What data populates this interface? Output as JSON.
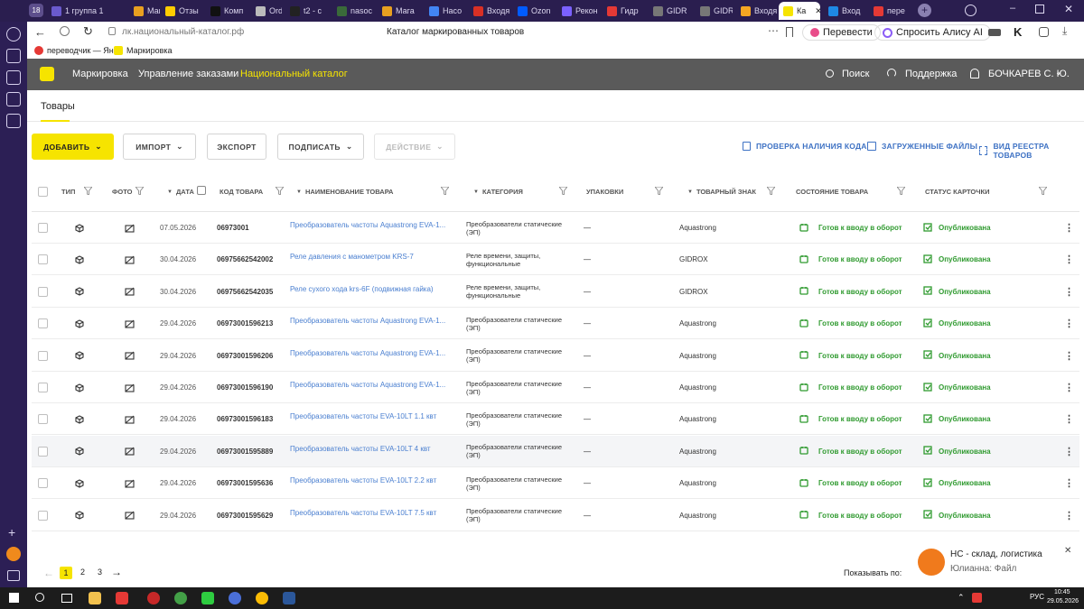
{
  "browser": {
    "tab_count": "18",
    "tabs": [
      {
        "label": "1  группа 1",
        "color": "#6a5acd"
      },
      {
        "label": "Мага",
        "color": "#e8a020"
      },
      {
        "label": "Отзы",
        "color": "#ffcc00"
      },
      {
        "label": "Комп",
        "color": "#111111"
      },
      {
        "label": "Order",
        "color": "#bbbbbb"
      },
      {
        "label": "t2 - c",
        "color": "#222222"
      },
      {
        "label": "nasос",
        "color": "#3a6a3a"
      },
      {
        "label": "Мага",
        "color": "#e8a020"
      },
      {
        "label": "Насо",
        "color": "#4285f4"
      },
      {
        "label": "Входя",
        "color": "#d93025"
      },
      {
        "label": "Ozon",
        "color": "#005bff"
      },
      {
        "label": "Рекон",
        "color": "#7b61ff"
      },
      {
        "label": "Гидр",
        "color": "#e53935"
      },
      {
        "label": "GIDR",
        "color": "#777777"
      },
      {
        "label": "GIDR",
        "color": "#777777"
      },
      {
        "label": "Входя",
        "color": "#f5a623"
      },
      {
        "label": "Ка",
        "color": "#f6e400"
      },
      {
        "label": "Вход",
        "color": "#1e88e5"
      },
      {
        "label": "пере",
        "color": "#e53935"
      }
    ],
    "url": "лк.национальный-каталог.рф",
    "page_title": "Каталог маркированных товаров",
    "translate_label": "Перевести",
    "alice_label": "Спросить Алису AI",
    "bookmarks": [
      "переводчик — Ян",
      "Маркировка"
    ]
  },
  "app": {
    "nav": [
      "Маркировка",
      "Управление заказами",
      "Национальный каталог"
    ],
    "search_label": "Поиск",
    "support_label": "Поддержка",
    "user_label": "БОЧКАРЕВ С. Ю.",
    "subnav_tab": "Товары"
  },
  "toolbar": {
    "add_label": "ДОБАВИТЬ",
    "import_label": "ИМПОРТ",
    "export_label": "ЭКСПОРТ",
    "sign_label": "ПОДПИСАТЬ",
    "action_label": "ДЕЙСТВИЕ",
    "check_code_label": "ПРОВЕРКА НАЛИЧИЯ КОДА",
    "uploaded_files_label": "ЗАГРУЖЕННЫЕ ФАЙЛЫ",
    "registry_view_label": "ВИД РЕЕСТРА ТОВАРОВ"
  },
  "table": {
    "columns": [
      "ТИП",
      "ФОТО",
      "ДАТА",
      "КОД ТОВАРА",
      "НАИМЕНОВАНИЕ ТОВАРА",
      "КАТЕГОРИЯ",
      "УПАКОВКИ",
      "ТОВАРНЫЙ ЗНАК",
      "СОСТОЯНИЕ ТОВАРА",
      "СТАТУС КАРТОЧКИ"
    ],
    "rows": [
      {
        "date": "07.05.2026",
        "code": "06973001",
        "name": "Преобразователь частоты Aquastrong EVA-1...",
        "category": "Преобразователи статические (ЭП)",
        "pack": "—",
        "brand": "Aquastrong",
        "state": "Готов к вводу в оборот",
        "status": "Опубликована"
      },
      {
        "date": "30.04.2026",
        "code": "06975662542002",
        "name": "Реле давления с манометром KRS-7",
        "category": "Реле времени, защиты, функциональные",
        "pack": "—",
        "brand": "GIDROX",
        "state": "Готов к вводу в оборот",
        "status": "Опубликована"
      },
      {
        "date": "30.04.2026",
        "code": "06975662542035",
        "name": "Реле сухого хода krs-6F (подвижная гайка)",
        "category": "Реле времени, защиты, функциональные",
        "pack": "—",
        "brand": "GIDROX",
        "state": "Готов к вводу в оборот",
        "status": "Опубликована"
      },
      {
        "date": "29.04.2026",
        "code": "06973001596213",
        "name": "Преобразователь частоты Aquastrong EVA-1...",
        "category": "Преобразователи статические (ЭП)",
        "pack": "—",
        "brand": "Aquastrong",
        "state": "Готов к вводу в оборот",
        "status": "Опубликована"
      },
      {
        "date": "29.04.2026",
        "code": "06973001596206",
        "name": "Преобразователь частоты Aquastrong EVA-1...",
        "category": "Преобразователи статические (ЭП)",
        "pack": "—",
        "brand": "Aquastrong",
        "state": "Готов к вводу в оборот",
        "status": "Опубликована"
      },
      {
        "date": "29.04.2026",
        "code": "06973001596190",
        "name": "Преобразователь частоты Aquastrong EVA-1...",
        "category": "Преобразователи статические (ЭП)",
        "pack": "—",
        "brand": "Aquastrong",
        "state": "Готов к вводу в оборот",
        "status": "Опубликована"
      },
      {
        "date": "29.04.2026",
        "code": "06973001596183",
        "name": "Преобразователь частоты EVA-10LT 1.1 квт",
        "category": "Преобразователи статические (ЭП)",
        "pack": "—",
        "brand": "Aquastrong",
        "state": "Готов к вводу в оборот",
        "status": "Опубликована"
      },
      {
        "date": "29.04.2026",
        "code": "06973001595889",
        "name": "Преобразователь частоты EVA-10LT 4 квт",
        "category": "Преобразователи статические (ЭП)",
        "pack": "—",
        "brand": "Aquastrong",
        "state": "Готов к вводу в оборот",
        "status": "Опубликована"
      },
      {
        "date": "29.04.2026",
        "code": "06973001595636",
        "name": "Преобразователь частоты EVA-10LT 2.2 квт",
        "category": "Преобразователи статические (ЭП)",
        "pack": "—",
        "brand": "Aquastrong",
        "state": "Готов к вводу в оборот",
        "status": "Опубликована"
      },
      {
        "date": "29.04.2026",
        "code": "06973001595629",
        "name": "Преобразователь частоты EVA-10LT 7.5 квт",
        "category": "Преобразователи статические (ЭП)",
        "pack": "—",
        "brand": "Aquastrong",
        "state": "Готов к вводу в оборот",
        "status": "Опубликована"
      }
    ]
  },
  "pagination": {
    "pages": [
      "1",
      "2",
      "3"
    ],
    "show_label": "Показывать по:"
  },
  "toast": {
    "title": "НС - склад, логистика",
    "body": "Юлианна: Файл"
  },
  "taskbar": {
    "lang": "РУС",
    "time": "10:45",
    "date": "29.05.2026"
  },
  "colors": {
    "accent_yellow": "#f6e400",
    "link_blue": "#4a7fd0",
    "status_green": "#2f9a2f",
    "header_gray": "#5a5a5a"
  }
}
